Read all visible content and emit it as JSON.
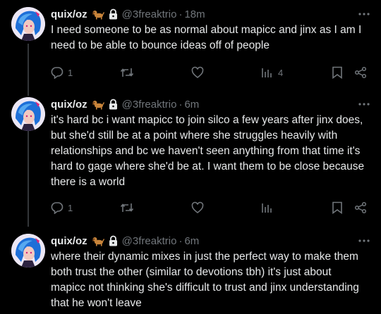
{
  "tweets": [
    {
      "name": "quix/oz",
      "emoji": "dog-emoji",
      "handle": "@3freaktrio",
      "separator": "·",
      "time": "18m",
      "text": "I need someone to be as normal about mapicc and jinx as I am I need to be able to bounce ideas off of people",
      "reply_count": "1",
      "views_count": "4"
    },
    {
      "name": "quix/oz",
      "emoji": "dog-emoji",
      "handle": "@3freaktrio",
      "separator": "·",
      "time": "6m",
      "text": "it's hard bc i want mapicc to join silco a few years after jinx does, but she'd still be at a point where she struggles heavily with relationships and bc we haven't seen anything from that time it's hard to gage where she'd be at. I want them to be close because there is a world",
      "reply_count": "1",
      "views_count": ""
    },
    {
      "name": "quix/oz",
      "emoji": "dog-emoji",
      "handle": "@3freaktrio",
      "separator": "·",
      "time": "6m",
      "text": "where their dynamic mixes in just the perfect way to make them both trust the other (similar to devotions tbh) it's just about mapicc not thinking she's difficult to trust and jinx understanding that he won't leave"
    }
  ],
  "colors": {
    "background": "#000000",
    "text": "#e7e9ea",
    "muted": "#71767b",
    "thread_line": "#333639"
  }
}
